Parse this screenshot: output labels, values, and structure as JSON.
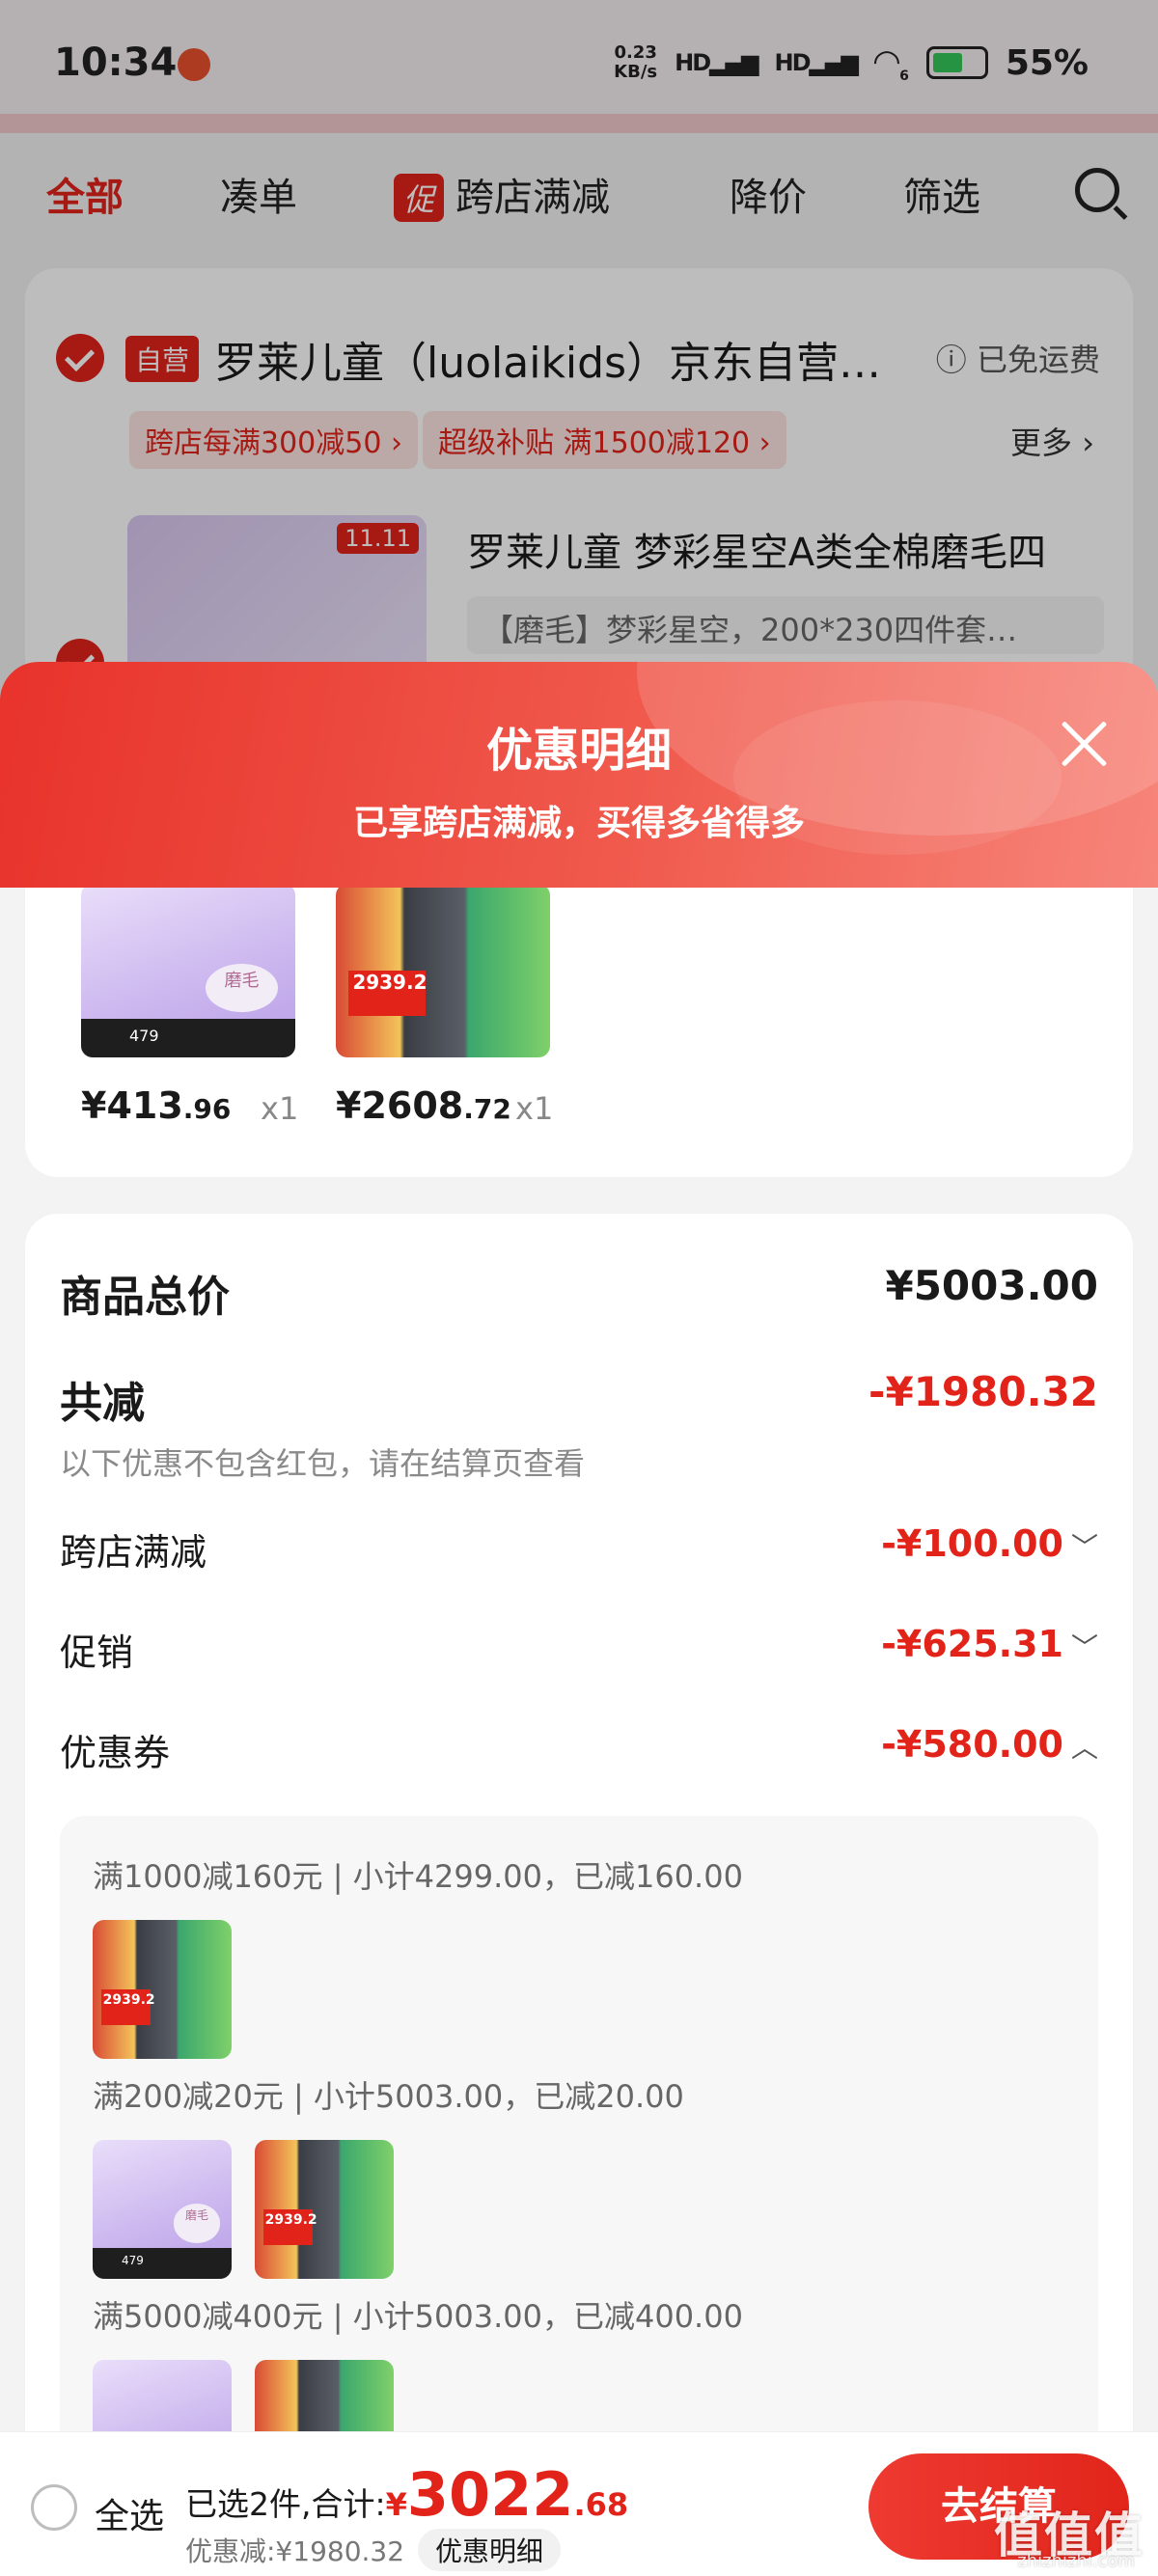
{
  "status_bar": {
    "time": "10:34",
    "network_speed_value": "0.23",
    "network_speed_unit": "KB/s",
    "signal1": "HD",
    "signal2": "HD",
    "wifi_level": "6",
    "battery": "55%"
  },
  "filter_tabs": {
    "all": "全部",
    "bundle": "凑单",
    "promo_tag": "促",
    "cross_store": "跨店满减",
    "price_drop": "降价",
    "filter": "筛选"
  },
  "store": {
    "badge": "自营",
    "name": "罗莱儿童（luolaikids）京东自营旗舰店",
    "shipping": "已免运费",
    "promo_chips": [
      "跨店每满300减50 ›",
      "超级补贴  满1500减120 ›"
    ],
    "more": "更多 ›",
    "product_title": "罗莱儿童 梦彩星空A类全棉磨毛四",
    "product_sku": "【磨毛】梦彩星空，200*230四件套…",
    "product_badge": "11.11"
  },
  "sheet": {
    "title": "优惠明细",
    "subtitle": "已享跨店满减，买得多省得多"
  },
  "goods": [
    {
      "price_int": "¥413",
      "price_dec": ".96",
      "qty": "x1"
    },
    {
      "price_int": "¥2608",
      "price_dec": ".72",
      "qty": "x1"
    }
  ],
  "thumb_text": {
    "mo": "磨毛",
    "bed_price": "479",
    "fridge_price": "2939.2"
  },
  "details": {
    "total_label": "商品总价",
    "total_value": "¥5003.00",
    "reduce_label": "共减",
    "reduce_value": "-¥1980.32",
    "reduce_note": "以下优惠不包含红包，请在结算页查看",
    "cross_label": "跨店满减",
    "cross_value": "-¥100.00",
    "promo_label": "促销",
    "promo_value": "-¥625.31",
    "coupon_label": "优惠券",
    "coupon_value": "-¥580.00"
  },
  "coupon_lines": [
    "满1000减160元 | 小计4299.00，已减160.00",
    "满200减20元 | 小计5003.00，已减20.00",
    "满5000减400元 | 小计5003.00，已减400.00"
  ],
  "bottom_bar": {
    "select_all": "全选",
    "selected_text": "已选2件,合计:",
    "currency": "¥",
    "total_int": "3022",
    "total_dec": ".68",
    "discount_text": "优惠减:¥1980.32",
    "detail_pill": "优惠明细",
    "checkout": "去结算"
  },
  "watermark": "值值值",
  "watermark_url": "zhizhizhi.com",
  "colors": {
    "accent": "#e2231a",
    "sheet_gradient_start": "#e8332b",
    "sheet_gradient_end": "#f7857a"
  }
}
